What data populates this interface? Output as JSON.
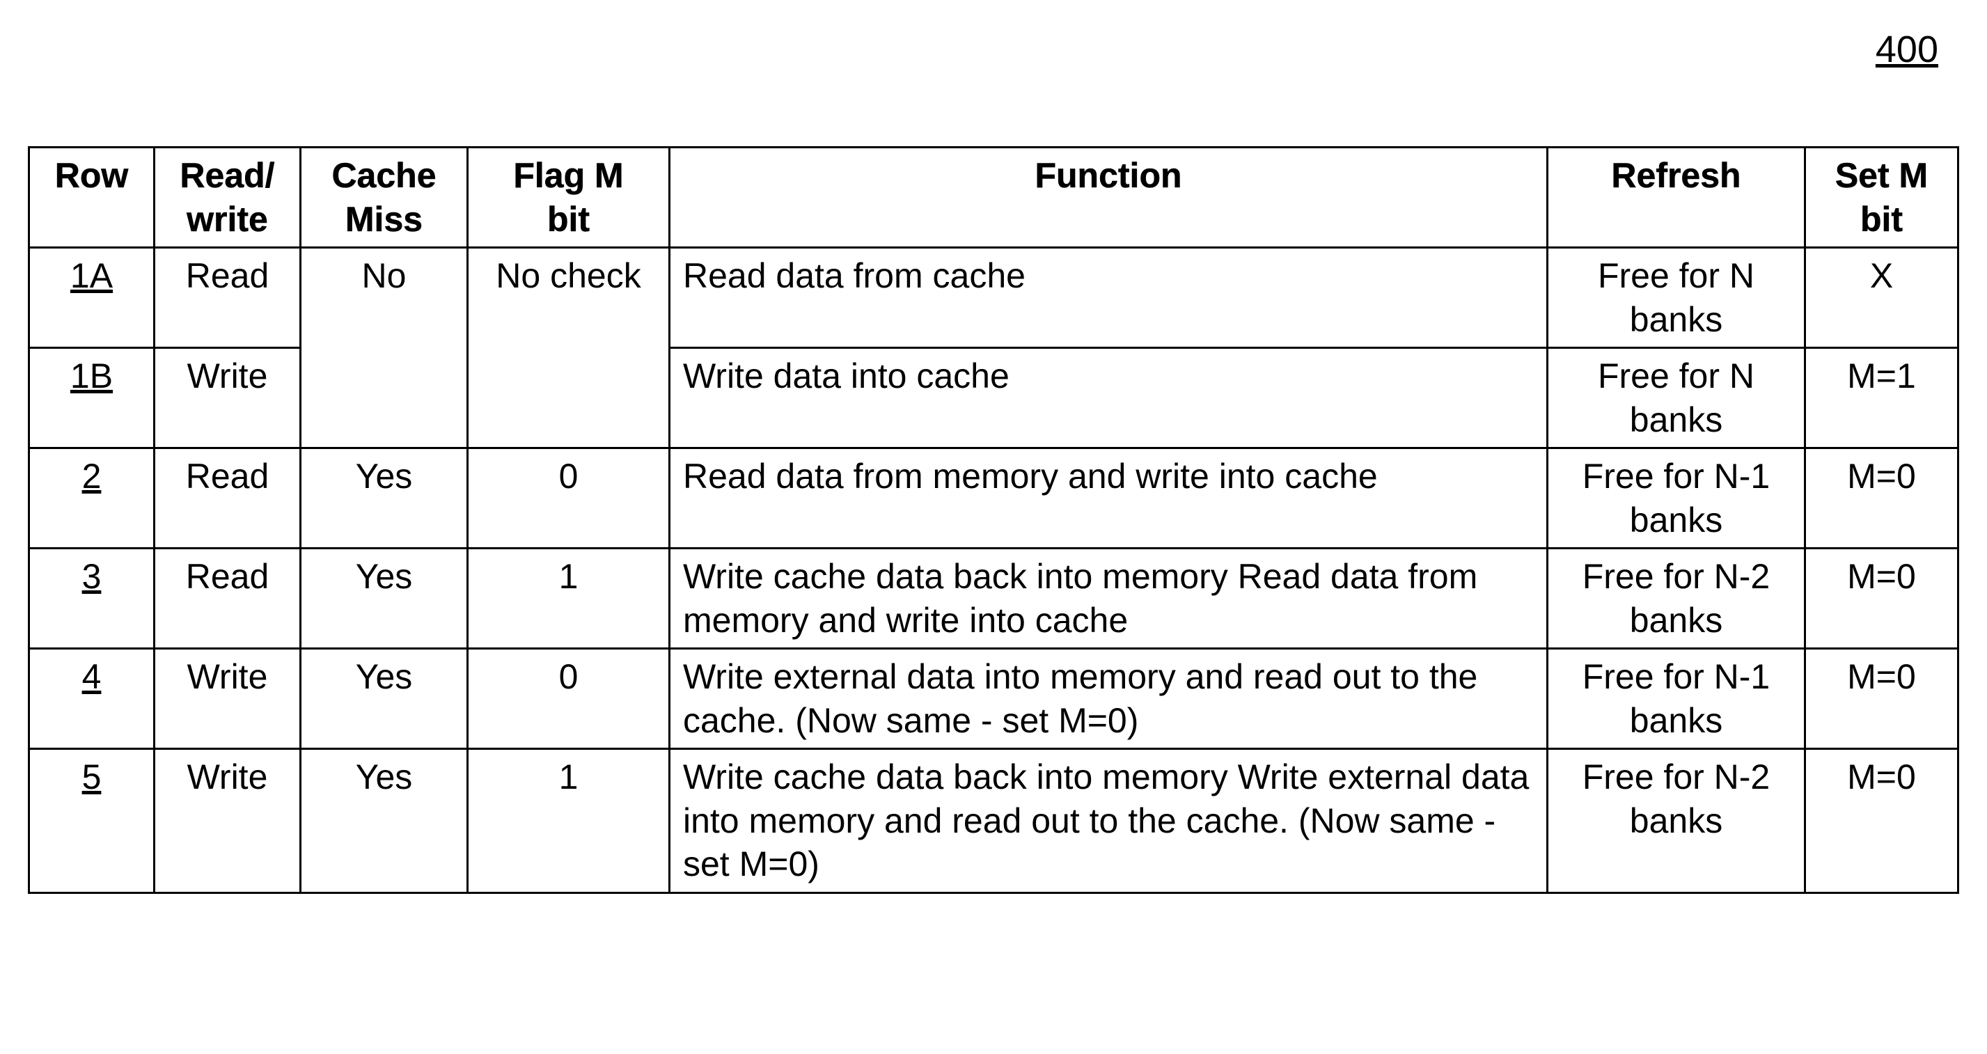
{
  "figure_ref": "400",
  "headers": {
    "row": "Row",
    "read_write": "Read/\nwrite",
    "cache_miss": "Cache\nMiss",
    "flag_m_bit": "Flag M\nbit",
    "function": "Function",
    "refresh": "Refresh",
    "set_m_bit": "Set M\nbit"
  },
  "merged": {
    "cache_miss_1": "No",
    "flag_m_bit_1": "No check"
  },
  "rows": {
    "r1a": {
      "row": "1A",
      "rw": "Read",
      "func": "Read data from cache",
      "refresh": "Free for N banks",
      "setm": "X"
    },
    "r1b": {
      "row": "1B",
      "rw": "Write",
      "func": "Write data into cache",
      "refresh": "Free for N banks",
      "setm": "M=1"
    },
    "r2": {
      "row": "2",
      "rw": "Read",
      "miss": "Yes",
      "flag": "0",
      "func": "Read data from memory and write into cache",
      "refresh": "Free for N-1 banks",
      "setm": "M=0"
    },
    "r3": {
      "row": "3",
      "rw": "Read",
      "miss": "Yes",
      "flag": "1",
      "func": "Write cache data back into memory Read data from memory and write into cache",
      "refresh": "Free for N-2 banks",
      "setm": "M=0"
    },
    "r4": {
      "row": "4",
      "rw": "Write",
      "miss": "Yes",
      "flag": "0",
      "func": "Write external data into memory and read out to the cache. (Now same - set M=0)",
      "refresh": "Free for N-1 banks",
      "setm": "M=0"
    },
    "r5": {
      "row": "5",
      "rw": "Write",
      "miss": "Yes",
      "flag": "1",
      "func": "Write cache data back into memory Write external data into memory and read out to the cache. (Now same - set M=0)",
      "refresh": "Free for N-2 banks",
      "setm": "M=0"
    }
  }
}
